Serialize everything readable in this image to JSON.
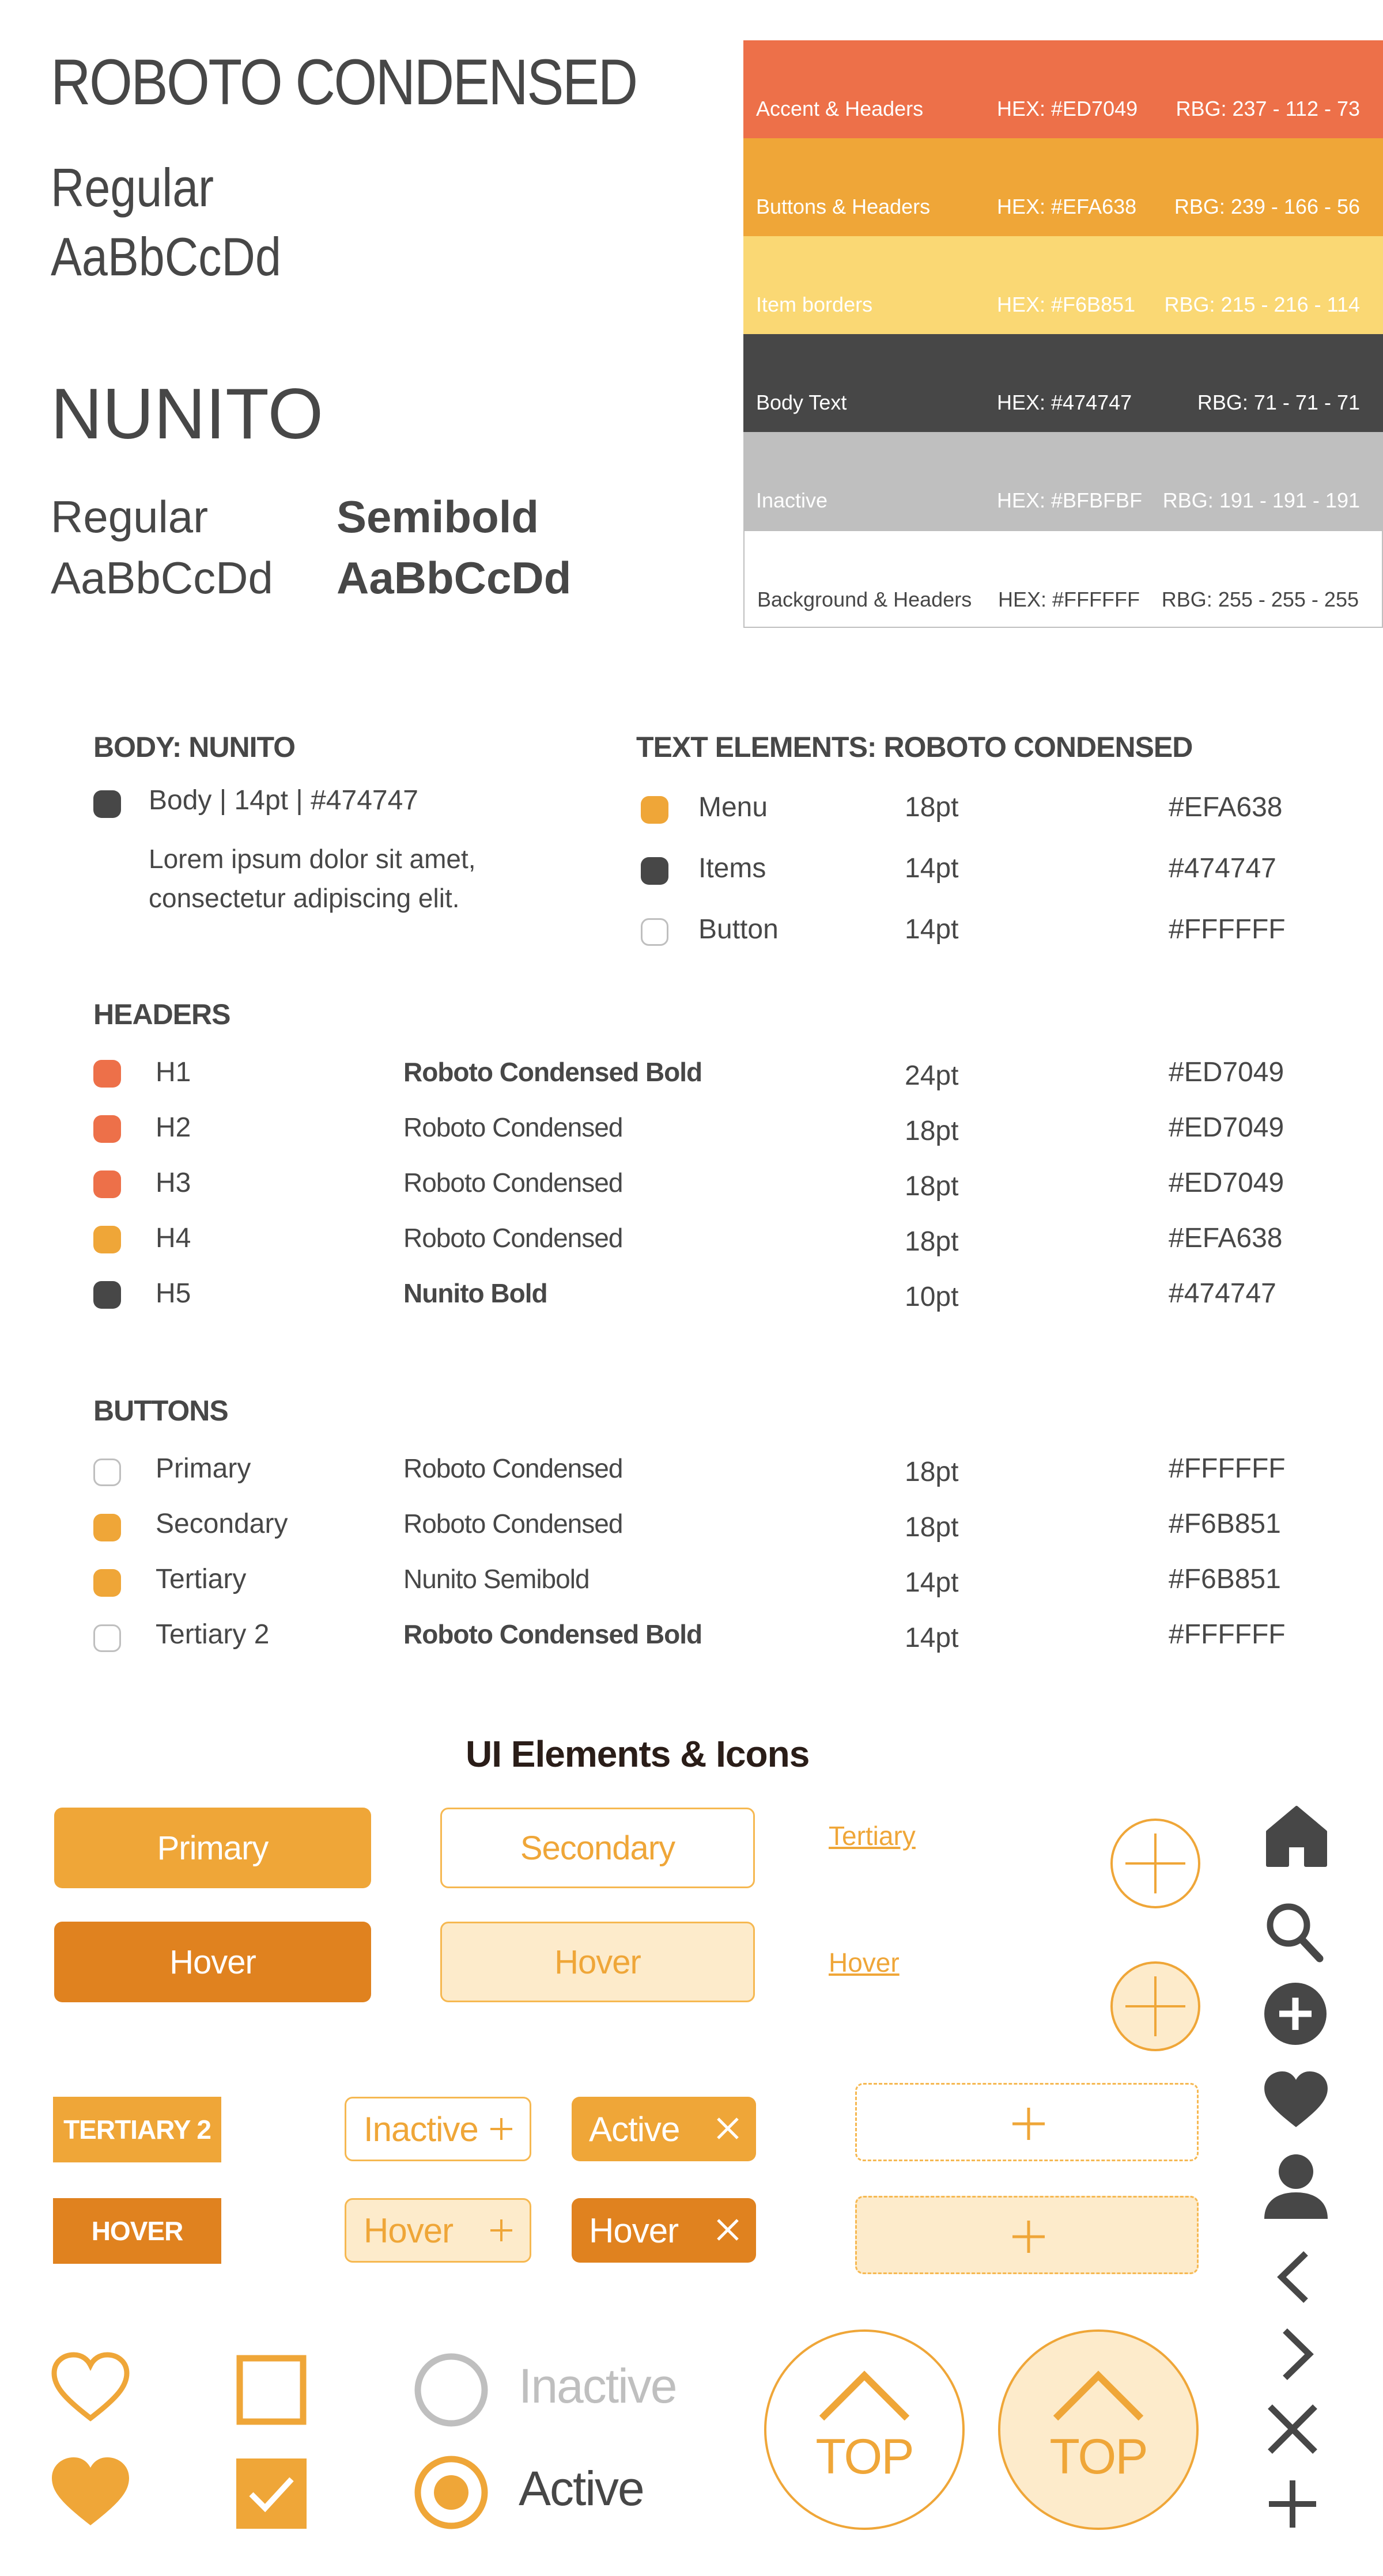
{
  "fonts": {
    "roboto": {
      "title": "ROBOTO CONDENSED",
      "weight": "Regular",
      "sample": "AaBbCcDd"
    },
    "nunito": {
      "title": "NUNITO",
      "regular_weight": "Regular",
      "regular_sample": "AaBbCcDd",
      "semibold_weight": "Semibold",
      "semibold_sample": "AaBbCcDd"
    }
  },
  "palette": [
    {
      "name": "Accent & Headers",
      "hex": "HEX: #ED7049",
      "rgb": "RBG: 237 - 112 - 73",
      "color": "#ED7049",
      "text_color": "#FFFFFF"
    },
    {
      "name": "Buttons & Headers",
      "hex": "HEX: #EFA638",
      "rgb": "RBG: 239 - 166 - 56",
      "color": "#EFA638",
      "text_color": "#FFFFFF"
    },
    {
      "name": "Item borders",
      "hex": "HEX: #F6B851",
      "rgb": "RBG: 215 - 216 - 114",
      "color": "#FAD874",
      "text_color": "#FFFFFF"
    },
    {
      "name": "Body Text",
      "hex": "HEX: #474747",
      "rgb": "RBG: 71 - 71 - 71",
      "color": "#474747",
      "text_color": "#FFFFFF"
    },
    {
      "name": "Inactive",
      "hex": "HEX: #BFBFBF",
      "rgb": "RBG: 191 - 191 - 191",
      "color": "#BFBFBF",
      "text_color": "#FFFFFF"
    },
    {
      "name": "Background & Headers",
      "hex": "HEX: #FFFFFF",
      "rgb": "RBG: 255 - 255 - 255",
      "color": "#FFFFFF",
      "text_color": "#474747"
    }
  ],
  "body_section": {
    "heading": "BODY: NUNITO",
    "spec": "Body | 14pt | #474747",
    "spec_color": "#474747",
    "lorem_1": "Lorem ipsum dolor sit amet,",
    "lorem_2": "consectetur adipiscing elit."
  },
  "text_elements": {
    "heading": "TEXT ELEMENTS: ROBOTO CONDENSED",
    "rows": [
      {
        "name": "Menu",
        "size": "18pt",
        "hex": "#EFA638",
        "color": "#EFA638"
      },
      {
        "name": "Items",
        "size": "14pt",
        "hex": "#474747",
        "color": "#474747"
      },
      {
        "name": "Button",
        "size": "14pt",
        "hex": "#FFFFFF",
        "color": "#FFFFFF"
      }
    ]
  },
  "headers": {
    "heading": "HEADERS",
    "rows": [
      {
        "name": "H1",
        "font": "Roboto Condensed Bold",
        "size": "24pt",
        "hex": "#ED7049",
        "color": "#ED7049"
      },
      {
        "name": "H2",
        "font": "Roboto Condensed",
        "size": "18pt",
        "hex": "#ED7049",
        "color": "#ED7049"
      },
      {
        "name": "H3",
        "font": "Roboto Condensed",
        "size": "18pt",
        "hex": "#ED7049",
        "color": "#ED7049"
      },
      {
        "name": "H4",
        "font": "Roboto Condensed",
        "size": "18pt",
        "hex": "#EFA638",
        "color": "#EFA638"
      },
      {
        "name": "H5",
        "font": "Nunito Bold",
        "size": "10pt",
        "hex": "#474747",
        "color": "#474747"
      }
    ]
  },
  "buttons_spec": {
    "heading": "BUTTONS",
    "rows": [
      {
        "name": "Primary",
        "font": "Roboto Condensed",
        "size": "18pt",
        "hex": "#FFFFFF",
        "color": "#FFFFFF"
      },
      {
        "name": "Secondary",
        "font": "Roboto Condensed",
        "size": "18pt",
        "hex": "#F6B851",
        "color": "#EFA638"
      },
      {
        "name": "Tertiary",
        "font": "Nunito Semibold",
        "size": "14pt",
        "hex": "#F6B851",
        "color": "#EFA638"
      },
      {
        "name": "Tertiary 2",
        "font": "Roboto Condensed Bold",
        "size": "14pt",
        "hex": "#FFFFFF",
        "color": "#FFFFFF"
      }
    ]
  },
  "ui": {
    "heading": "UI Elements & Icons",
    "primary": "Primary",
    "secondary": "Secondary",
    "tertiary": "Tertiary",
    "hover": "Hover",
    "tertiary2": "TERTIARY 2",
    "hover_caps": "HOVER",
    "inactive": "Inactive",
    "active": "Active",
    "top": "TOP",
    "colors": {
      "orange": "#EFA638",
      "dark_orange": "#E0821F",
      "pale": "#FDEBCB",
      "border": "#F6B851",
      "gray": "#BFBFBF",
      "text": "#474747"
    },
    "icons": [
      "home-icon",
      "search-icon",
      "add-circle-icon",
      "heart-icon",
      "user-icon",
      "chevron-left-icon",
      "chevron-right-icon",
      "close-icon",
      "plus-icon"
    ]
  }
}
